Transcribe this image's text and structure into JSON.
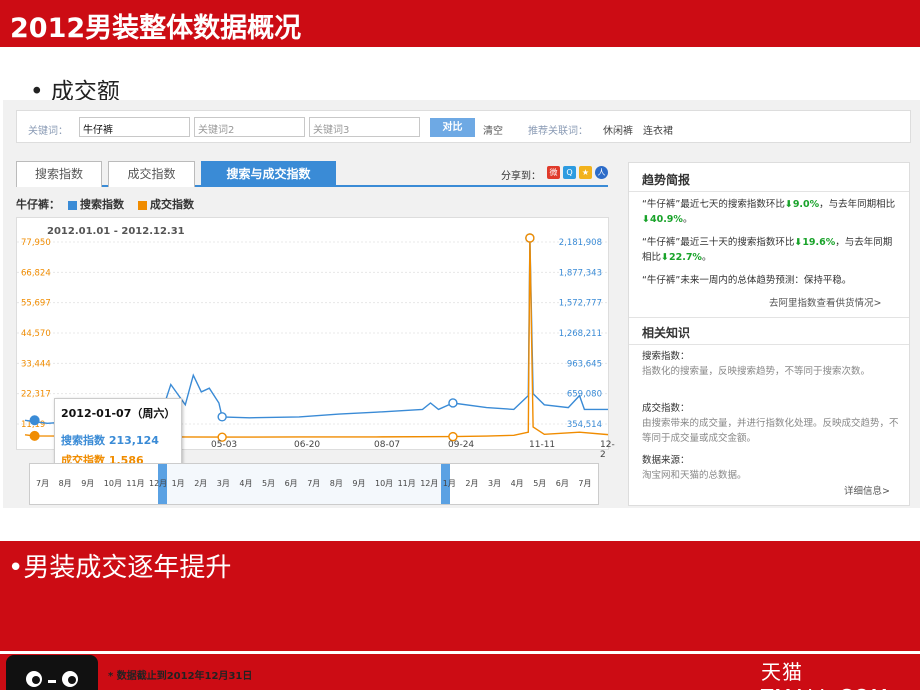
{
  "slide": {
    "title": "2012男装整体数据概况",
    "bullet1": "•  成交额",
    "bullet2": "•男装成交逐年提升",
    "footnote": "* 数据截止到2012年12月31日",
    "brand": "天猫 TMALL.COM"
  },
  "search": {
    "keyword_label": "关键词：",
    "keyword1": "牛仔裤",
    "keyword2_placeholder": "关键词2",
    "keyword3_placeholder": "关键词3",
    "compare_button": "对比",
    "clear_link": "清空",
    "related_label": "推荐关联词：",
    "related": [
      "休闲裤",
      "连衣裙"
    ]
  },
  "tabs": [
    "搜索指数",
    "成交指数",
    "搜索与成交指数"
  ],
  "share_label": "分享到：",
  "legend": {
    "keyword": "牛仔裤：",
    "search": "搜索指数",
    "deal": "成交指数"
  },
  "colors": {
    "search": "#3a8bd6",
    "deal": "#f08c00",
    "accent": "#cc0c14",
    "down": "#19a32a"
  },
  "tooltip": {
    "date": "2012-01-07",
    "weekday": "周六",
    "search_label": "搜索指数",
    "search_value": "213,124",
    "deal_label": "成交指数",
    "deal_value": "1,586"
  },
  "chart_data": {
    "type": "line",
    "title": "2012.01.01 - 2012.12.31",
    "x_ticks": [
      "01",
      "05-03",
      "06-20",
      "08-07",
      "09-24",
      "11-11",
      "12-2"
    ],
    "y_left_ticks": [
      "77,950",
      "66,824",
      "55,697",
      "44,570",
      "33,444",
      "22,317",
      "11,19"
    ],
    "y_right_ticks": [
      "2,181,908",
      "1,877,343",
      "1,572,777",
      "1,268,211",
      "963,645",
      "659,080",
      "354,514"
    ],
    "series": [
      {
        "name": "搜索指数",
        "x": [
          "01-01",
          "01-15",
          "02-01",
          "02-15",
          "03-01",
          "03-15",
          "03-25",
          "04-01",
          "04-10",
          "04-15",
          "04-20",
          "04-25",
          "05-01",
          "05-03",
          "05-20",
          "06-20",
          "07-15",
          "08-07",
          "09-05",
          "09-10",
          "09-15",
          "09-24",
          "10-15",
          "11-01",
          "11-10",
          "11-11",
          "11-13",
          "11-20",
          "12-05",
          "12-12",
          "12-15",
          "12-31"
        ],
        "values": [
          213124,
          180000,
          200000,
          180000,
          170000,
          200000,
          230000,
          600000,
          380000,
          700000,
          520000,
          560000,
          400000,
          250000,
          240000,
          250000,
          280000,
          300000,
          330000,
          400000,
          330000,
          400000,
          350000,
          330000,
          480000,
          2181908,
          500000,
          380000,
          350000,
          480000,
          330000,
          330000
        ]
      },
      {
        "name": "成交指数",
        "x": [
          "01-01",
          "01-07",
          "02-01",
          "03-01",
          "04-01",
          "05-03",
          "06-20",
          "08-07",
          "09-24",
          "10-15",
          "11-01",
          "11-10",
          "11-11",
          "11-13",
          "11-20",
          "12-12",
          "12-31"
        ],
        "values": [
          2000,
          1586,
          1500,
          1300,
          1200,
          1100,
          1200,
          1200,
          1300,
          1500,
          1800,
          3000,
          77950,
          5000,
          2200,
          3000,
          2000
        ]
      }
    ],
    "ylim_left": [
      0,
      77950
    ],
    "ylim_right": [
      0,
      2181908
    ],
    "grid": true,
    "legend": "top-left"
  },
  "timeline": {
    "months": [
      "7月",
      "8月",
      "9月",
      "10月",
      "11月",
      "12月",
      "1月",
      "2月",
      "3月",
      "4月",
      "5月",
      "6月",
      "7月",
      "8月",
      "9月",
      "10月",
      "11月",
      "12月",
      "1月",
      "2月",
      "3月",
      "4月",
      "5月",
      "6月",
      "7月"
    ]
  },
  "trend": {
    "heading": "趋势简报",
    "line1_pre": "“牛仔裤”最近七天的搜索指数环比",
    "line1_val": "9.0%",
    "line1_mid": "，与去年同期相比",
    "line1_val2": "40.9%",
    "line1_end": "。",
    "line2_pre": "“牛仔裤”最近三十天的搜索指数环比",
    "line2_val": "19.6%",
    "line2_mid": "，与去年同期相比",
    "line2_val2": "22.7%",
    "line2_end": "。",
    "line3": "“牛仔裤”未来一周内的总体趋势预测：保持平稳。",
    "link": "去阿里指数查看供货情况>"
  },
  "knowledge": {
    "heading": "相关知识",
    "search_title": "搜索指数：",
    "search_desc": "指数化的搜索量，反映搜索趋势，不等同于搜索次数。",
    "deal_title": "成交指数：",
    "deal_desc": "由搜索带来的成交量，并进行指数化处理。反映成交趋势，不等同于成交量或成交金额。",
    "source_title": "数据来源：",
    "source_desc": "淘宝网和天猫的总数据。",
    "more_link": "详细信息>"
  }
}
